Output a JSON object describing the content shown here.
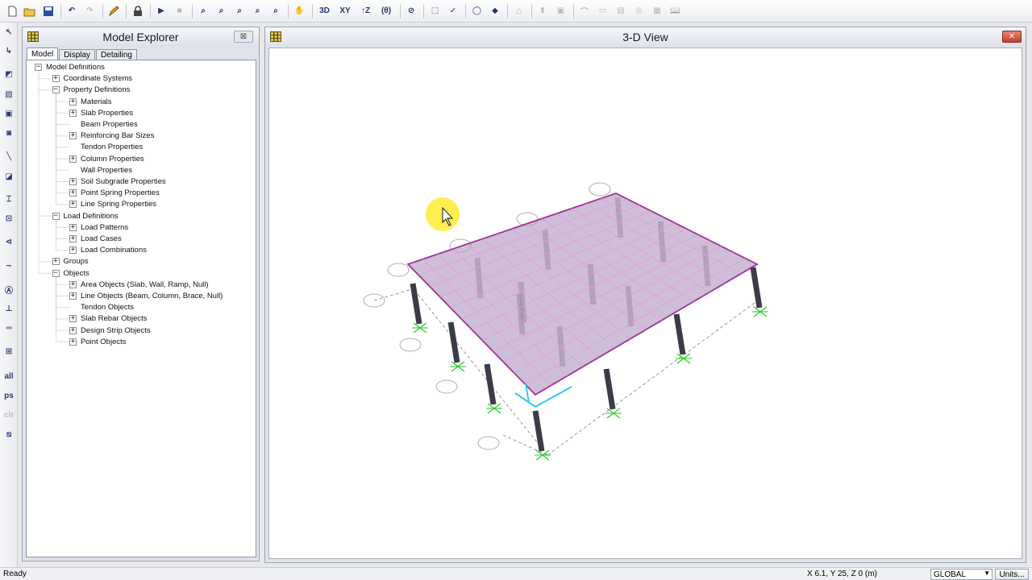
{
  "toolbar": {
    "btn_3d": "3D",
    "btn_xy": "XY",
    "btn_xz": "↑Z",
    "btn_rot": "(θ)"
  },
  "left_toolbar": {
    "all": "all",
    "ps": "ps",
    "clr": "clr"
  },
  "explorer": {
    "title": "Model Explorer",
    "tabs": [
      "Model",
      "Display",
      "Detailing"
    ],
    "tree": [
      {
        "label": "Model Definitions",
        "level": 0,
        "toggle": "minus"
      },
      {
        "label": "Coordinate Systems",
        "level": 1,
        "toggle": "plus"
      },
      {
        "label": "Property Definitions",
        "level": 1,
        "toggle": "minus"
      },
      {
        "label": "Materials",
        "level": 2,
        "toggle": "plus"
      },
      {
        "label": "Slab Properties",
        "level": 2,
        "toggle": "plus"
      },
      {
        "label": "Beam Properties",
        "level": 2,
        "toggle": "none"
      },
      {
        "label": "Reinforcing Bar Sizes",
        "level": 2,
        "toggle": "plus"
      },
      {
        "label": "Tendon Properties",
        "level": 2,
        "toggle": "none"
      },
      {
        "label": "Column Properties",
        "level": 2,
        "toggle": "plus"
      },
      {
        "label": "Wall Properties",
        "level": 2,
        "toggle": "none"
      },
      {
        "label": "Soil Subgrade Properties",
        "level": 2,
        "toggle": "plus"
      },
      {
        "label": "Point Spring Properties",
        "level": 2,
        "toggle": "plus"
      },
      {
        "label": "Line Spring Properties",
        "level": 2,
        "toggle": "plus"
      },
      {
        "label": "Load Definitions",
        "level": 1,
        "toggle": "minus"
      },
      {
        "label": "Load Patterns",
        "level": 2,
        "toggle": "plus"
      },
      {
        "label": "Load Cases",
        "level": 2,
        "toggle": "plus"
      },
      {
        "label": "Load Combinations",
        "level": 2,
        "toggle": "plus"
      },
      {
        "label": "Groups",
        "level": 1,
        "toggle": "plus"
      },
      {
        "label": "Objects",
        "level": 1,
        "toggle": "minus"
      },
      {
        "label": "Area Objects (Slab, Wall, Ramp, Null)",
        "level": 2,
        "toggle": "plus"
      },
      {
        "label": "Line Objects (Beam, Column, Brace, Null)",
        "level": 2,
        "toggle": "plus"
      },
      {
        "label": "Tendon Objects",
        "level": 2,
        "toggle": "none"
      },
      {
        "label": "Slab Rebar Objects",
        "level": 2,
        "toggle": "plus"
      },
      {
        "label": "Design Strip Objects",
        "level": 2,
        "toggle": "plus"
      },
      {
        "label": "Point Objects",
        "level": 2,
        "toggle": "plus"
      }
    ]
  },
  "view": {
    "title": "3-D View",
    "colors": {
      "slab_fill": "#b49bc2",
      "slab_edge": "#a0309a",
      "mesh": "#e49ae0",
      "column": "#3a3d48",
      "support": "#22cc22",
      "selection": "#33c8f0",
      "gridline": "#808080"
    }
  },
  "status": {
    "text": "Ready",
    "coords": "X 6.1,  Y 25,  Z 0  (m)",
    "coord_system": "GLOBAL",
    "units_label": "Units..."
  }
}
